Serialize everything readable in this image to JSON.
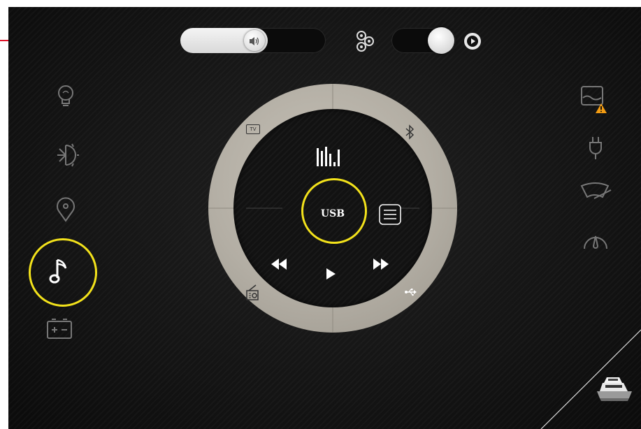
{
  "top_bar": {
    "volume_slider": {
      "level": 0.6,
      "icon": "speaker-icon"
    },
    "source_toggle": {
      "state": "on",
      "icon_left": "speakers-icon",
      "icon_right": "play-circle-icon"
    }
  },
  "left_nav": {
    "items": [
      {
        "name": "lighting",
        "icon": "lightbulb-icon"
      },
      {
        "name": "climate",
        "icon": "sun-snowflake-icon"
      },
      {
        "name": "navigation",
        "icon": "location-pin-icon"
      },
      {
        "name": "audio",
        "icon": "music-note-icon",
        "selected": true
      },
      {
        "name": "battery",
        "icon": "battery-icon"
      }
    ]
  },
  "right_nav": {
    "items": [
      {
        "name": "tank",
        "icon": "tank-level-warning-icon"
      },
      {
        "name": "shore-power",
        "icon": "plug-icon"
      },
      {
        "name": "wiper",
        "icon": "wiper-icon"
      },
      {
        "name": "gauge",
        "icon": "gauge-icon"
      }
    ]
  },
  "dial": {
    "center_label": "USB",
    "sources": [
      {
        "name": "tv",
        "label": "TV"
      },
      {
        "name": "bluetooth",
        "icon": "bluetooth-icon"
      },
      {
        "name": "radio",
        "icon": "radio-icon"
      },
      {
        "name": "usb",
        "icon": "usb-icon"
      }
    ],
    "controls": [
      "equalizer-icon",
      "list-icon",
      "rewind-icon",
      "play-icon",
      "fast-forward-icon"
    ]
  },
  "colors": {
    "highlight": "#f3e21b",
    "annotation_arrow": "#e0142a",
    "warning": "#f39c12"
  }
}
